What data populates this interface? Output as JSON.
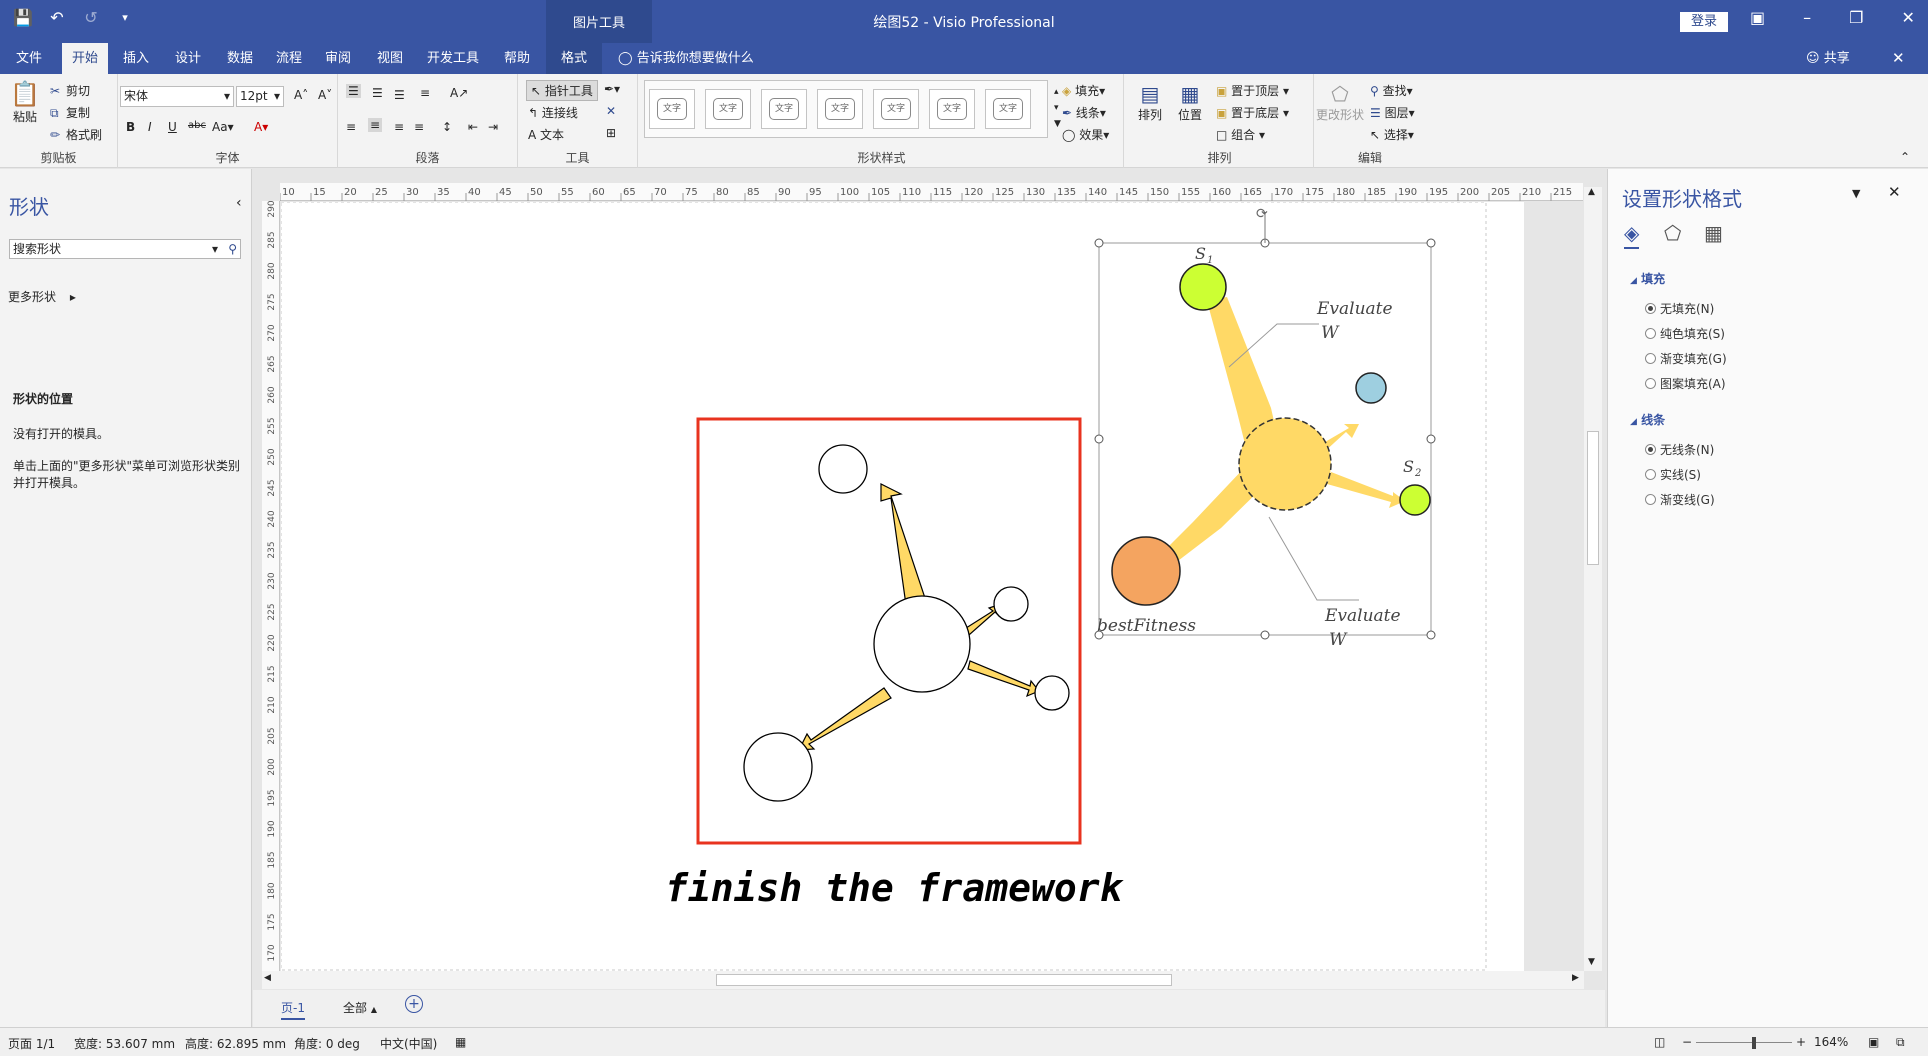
{
  "titlebar": {
    "context_tool": "图片工具",
    "title": "绘图52 - Visio Professional",
    "login": "登录"
  },
  "tabs": [
    "文件",
    "开始",
    "插入",
    "设计",
    "数据",
    "流程",
    "审阅",
    "视图",
    "开发工具",
    "帮助",
    "格式"
  ],
  "tellme": "告诉我你想要做什么",
  "share": "共享",
  "ribbon": {
    "clipboard": {
      "paste": "粘贴",
      "cut": "剪切",
      "copy": "复制",
      "format_painter": "格式刷",
      "label": "剪贴板"
    },
    "font": {
      "name": "宋体",
      "size": "12pt",
      "label": "字体"
    },
    "paragraph": {
      "label": "段落"
    },
    "tools": {
      "pointer": "指针工具",
      "connector": "连接线",
      "text": "文本",
      "label": "工具"
    },
    "shape_styles": {
      "sample": "文字",
      "fill": "填充",
      "line": "线条",
      "effect": "效果",
      "label": "形状样式"
    },
    "arrange": {
      "arrange": "排列",
      "position": "位置",
      "bring_front": "置于顶层",
      "send_back": "置于底层",
      "group": "组合",
      "label": "排列"
    },
    "editing": {
      "change_shape": "更改形状",
      "find": "查找",
      "layers": "图层",
      "select": "选择",
      "label": "编辑"
    }
  },
  "shapes_pane": {
    "title": "形状",
    "search_placeholder": "搜索形状",
    "more_shapes": "更多形状",
    "location_heading": "形状的位置",
    "no_stencil": "没有打开的模具。",
    "hint": "单击上面的\"更多形状\"菜单可浏览形状类别并打开模具。"
  },
  "ruler": {
    "h": [
      "10",
      "15",
      "20",
      "25",
      "30",
      "35",
      "40",
      "45",
      "50",
      "55",
      "60",
      "65",
      "70",
      "75",
      "80",
      "85",
      "90",
      "95",
      "100",
      "105",
      "110",
      "115",
      "120",
      "125",
      "130",
      "135",
      "140",
      "145",
      "150",
      "155",
      "160",
      "165",
      "170",
      "175",
      "180",
      "185",
      "190",
      "195",
      "200",
      "205",
      "210",
      "215"
    ],
    "v": [
      "290",
      "285",
      "280",
      "275",
      "270",
      "265",
      "260",
      "255",
      "250",
      "245",
      "240",
      "235",
      "230",
      "225",
      "220",
      "215",
      "210",
      "205",
      "200",
      "195",
      "190",
      "185",
      "180",
      "175",
      "170"
    ]
  },
  "diagram": {
    "caption": "finish the framework",
    "evaluate_top": "Evaluate",
    "evaluate_top_w": "W",
    "evaluate_bottom": "Evaluate",
    "evaluate_bottom_w": "W",
    "s1": "S",
    "s1_sub": "1",
    "s2": "S",
    "s2_sub": "2",
    "best_fitness": "bestFitness",
    "colors": {
      "arrow": "#ffd966",
      "hub": "#ffd966",
      "s1": "#ccff33",
      "s2": "#ccff33",
      "blue": "#9ecfe0",
      "orange": "#f4a460",
      "frame": "#e8331f"
    }
  },
  "page_tabs": {
    "page": "页-1",
    "all": "全部"
  },
  "format_pane": {
    "title": "设置形状格式",
    "fill_heading": "填充",
    "fill_options": [
      "无填充(N)",
      "纯色填充(S)",
      "渐变填充(G)",
      "图案填充(A)"
    ],
    "line_heading": "线条",
    "line_options": [
      "无线条(N)",
      "实线(S)",
      "渐变线(G)"
    ]
  },
  "statusbar": {
    "page": "页面 1/1",
    "width": "宽度: 53.607 mm",
    "height": "高度: 62.895 mm",
    "angle": "角度: 0 deg",
    "language": "中文(中国)",
    "zoom": "164%"
  }
}
